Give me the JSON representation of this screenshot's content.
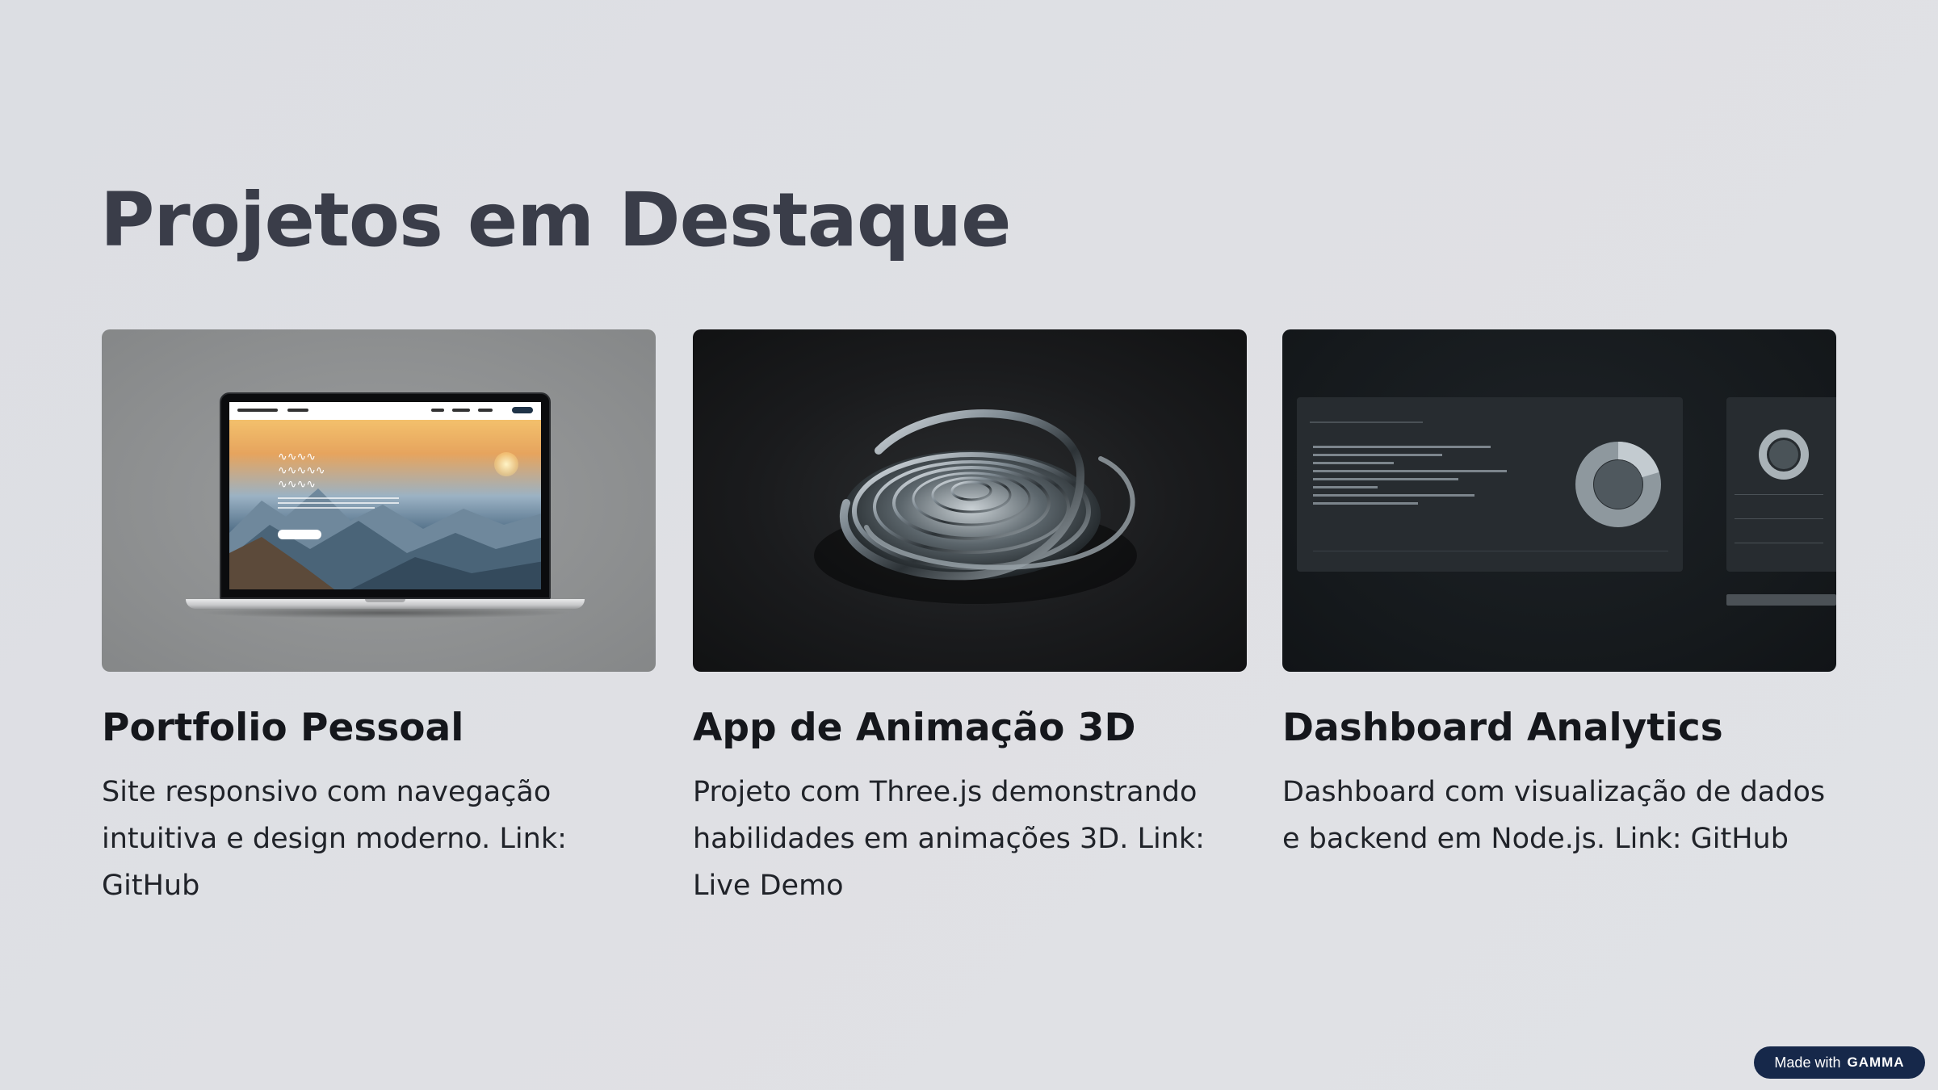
{
  "slide": {
    "title": "Projetos em Destaque"
  },
  "cards": [
    {
      "title": "Portfolio Pessoal",
      "description": "Site responsivo com navegação intuitiva e design moderno. Link: GitHub",
      "image_icon": "laptop-mockup-image"
    },
    {
      "title": "App de Animação 3D",
      "description": "Projeto com Three.js demonstrando habilidades em animações 3D. Link: Live Demo",
      "image_icon": "3d-swirl-image"
    },
    {
      "title": "Dashboard Analytics",
      "description": "Dashboard com visualização de dados e backend em Node.js. Link: GitHub",
      "image_icon": "dashboard-mockup-image"
    }
  ],
  "badge": {
    "prefix": "Made with",
    "brand": "GAMMA"
  },
  "colors": {
    "background": "#dfe0e4",
    "title": "#3a3d49",
    "text": "#15171c",
    "badge": "#16284a"
  }
}
